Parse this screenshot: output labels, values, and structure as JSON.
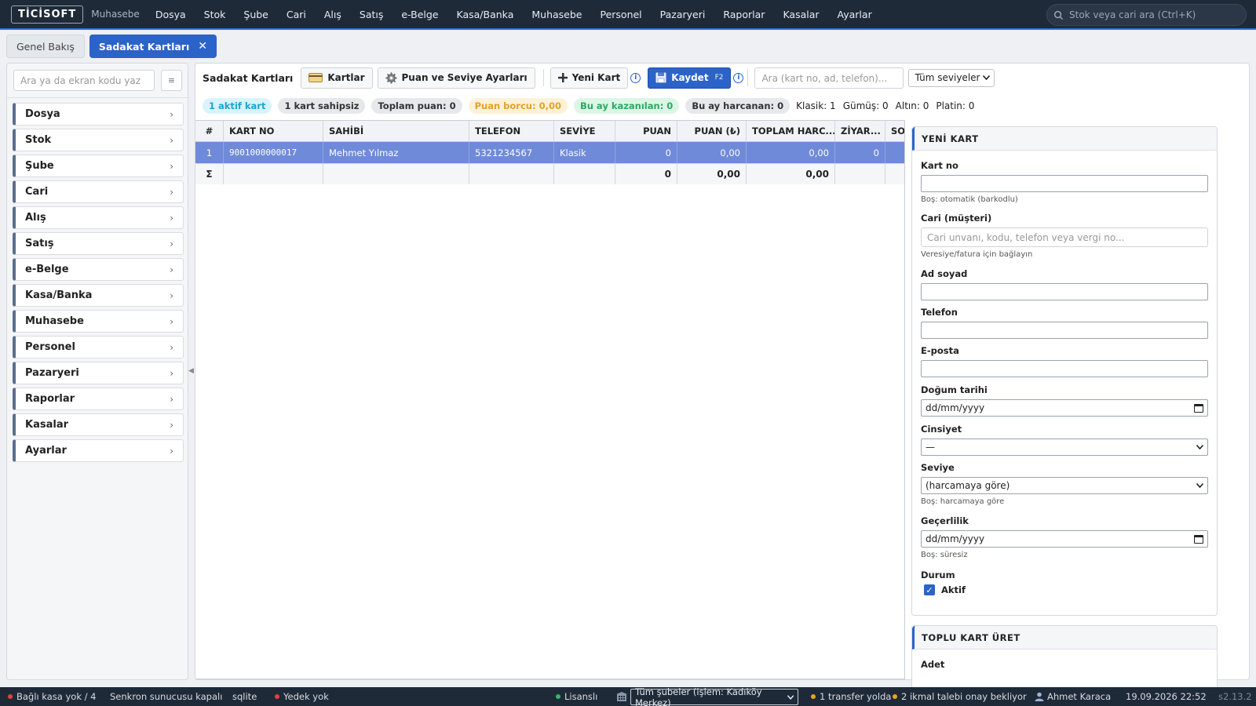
{
  "topbar": {
    "logo": "TİCİSOFT",
    "subtitle": "Muhasebe",
    "menu": [
      "Dosya",
      "Stok",
      "Şube",
      "Cari",
      "Alış",
      "Satış",
      "e-Belge",
      "Kasa/Banka",
      "Muhasebe",
      "Personel",
      "Pazaryeri",
      "Raporlar",
      "Kasalar",
      "Ayarlar"
    ],
    "search_placeholder": "Stok veya cari ara (Ctrl+K)"
  },
  "tabs": {
    "overview": "Genel Bakış",
    "active": "Sadakat Kartları",
    "close": "✕"
  },
  "sidebar": {
    "search_placeholder": "Ara ya da ekran kodu yaz",
    "grid_glyph": "≡",
    "items": [
      "Dosya",
      "Stok",
      "Şube",
      "Cari",
      "Alış",
      "Satış",
      "e-Belge",
      "Kasa/Banka",
      "Muhasebe",
      "Personel",
      "Pazaryeri",
      "Raporlar",
      "Kasalar",
      "Ayarlar"
    ],
    "chevron": "›",
    "collapse_glyph": "◀"
  },
  "toolbar": {
    "title": "Sadakat Kartları",
    "cards_button": "Kartlar",
    "settings_button": "Puan ve Seviye Ayarları",
    "new_card_button": "Yeni Kart",
    "save_button": "Kaydet",
    "save_shortcut": "F2",
    "info_glyph": "i",
    "search_placeholder": "Ara (kart no, ad, telefon)...",
    "level_filter": "Tüm seviyeler"
  },
  "stats": {
    "active": "1 aktif kart",
    "ownerless": "1 kart sahipsiz",
    "total_points": "Toplam puan: 0",
    "points_debt": "Puan borcu: 0,00",
    "earned_month": "Bu ay kazanılan: 0",
    "spent_month": "Bu ay harcanan: 0",
    "klasik": "Klasik: 1",
    "gumus": "Gümüş: 0",
    "altin": "Altın: 0",
    "platin": "Platin: 0"
  },
  "grid": {
    "columns": [
      "#",
      "KART NO",
      "SAHİBİ",
      "TELEFON",
      "SEVİYE",
      "PUAN",
      "PUAN (₺)",
      "TOPLAM HARC...",
      "ZİYAR...",
      "SO"
    ],
    "rows": [
      [
        "1",
        "9001000000017",
        "Mehmet Yılmaz",
        "5321234567",
        "Klasik",
        "0",
        "0,00",
        "0,00",
        "0",
        ""
      ]
    ],
    "summary": [
      "Σ",
      "",
      "",
      "",
      "",
      "0",
      "0,00",
      "0,00",
      "",
      ""
    ]
  },
  "form": {
    "title": "YENİ KART",
    "card_no_label": "Kart no",
    "card_no_value": "",
    "card_no_hint": "Boş: otomatik (barkodlu)",
    "customer_label": "Cari (müşteri)",
    "customer_placeholder": "Cari unvanı, kodu, telefon veya vergi no...",
    "customer_hint": "Veresiye/fatura için bağlayın",
    "name_label": "Ad soyad",
    "name_value": "",
    "phone_label": "Telefon",
    "phone_value": "",
    "email_label": "E-posta",
    "email_value": "",
    "birth_label": "Doğum tarihi",
    "birth_value": "dd/mm/yyyy",
    "gender_label": "Cinsiyet",
    "gender_value": "—",
    "level_label": "Seviye",
    "level_value": "(harcamaya göre)",
    "level_hint": "Boş: harcamaya göre",
    "validity_label": "Geçerlilik",
    "validity_value": "dd/mm/yyyy",
    "validity_hint": "Boş: süresiz",
    "status_label": "Durum",
    "active_label": "Aktif",
    "active_checked": true
  },
  "bulk": {
    "title": "TOPLU KART ÜRET",
    "count_label": "Adet"
  },
  "statusbar": {
    "cash": "Bağlı kasa yok / 4",
    "sync": "Senkron sunucusu kapalı",
    "db": "sqlite",
    "backup": "Yedek yok",
    "license": "Lisanslı",
    "branches": "Tüm şubeler (işlem: Kadıköy Merkez)",
    "transfers": "1 transfer yolda",
    "approvals": "2 ikmal talebi onay bekliyor",
    "user": "Ahmet Karaca",
    "datetime": "19.09.2026 22:52",
    "version": "s2.13.2"
  },
  "colors": {
    "accent": "#2b63c9",
    "topbar": "#1f2a38",
    "selected_row": "#6f8ad8",
    "dot_red": "#e0433b",
    "dot_green": "#35b56a",
    "dot_amber": "#f0a020"
  },
  "icons": [
    "search-icon",
    "card-icon",
    "gear-icon",
    "plus-icon",
    "save-icon",
    "info-icon",
    "calendar-icon",
    "check-icon",
    "user-icon",
    "branch-icon",
    "chevron-right-icon",
    "close-icon"
  ]
}
